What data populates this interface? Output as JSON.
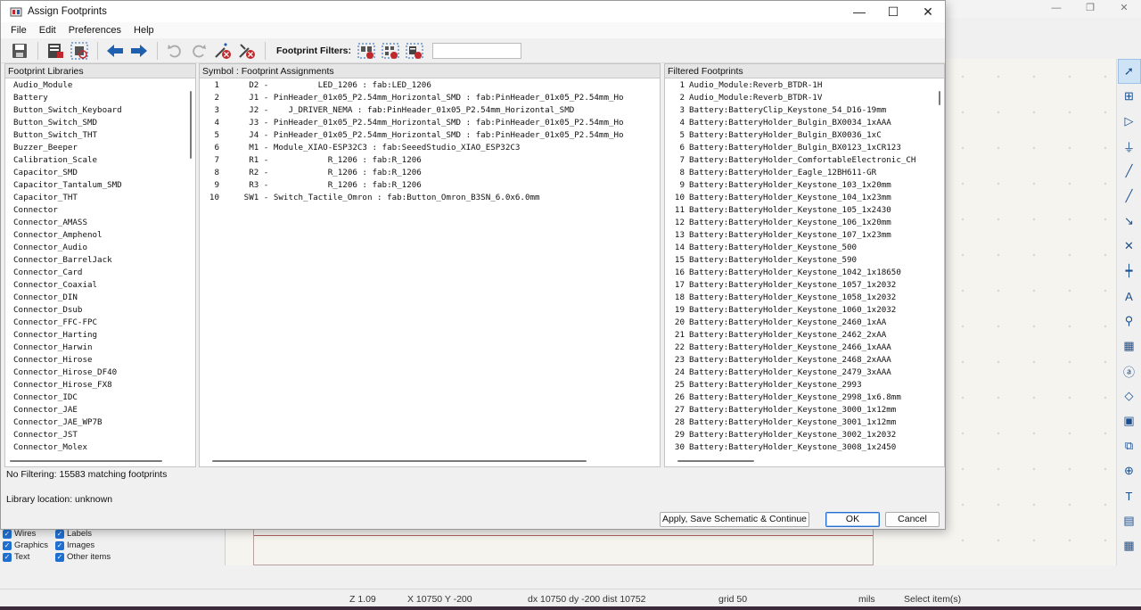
{
  "background": {
    "checkboxes": [
      {
        "label": "Wires"
      },
      {
        "label": "Labels"
      },
      {
        "label": "Graphics"
      },
      {
        "label": "Images"
      },
      {
        "label": "Text"
      },
      {
        "label": "Other items"
      }
    ],
    "status": {
      "zoom": "Z 1.09",
      "xy": "X 10750  Y -200",
      "delta": "dx 10750  dy -200  dist 10752",
      "grid": "grid 50",
      "units": "mils",
      "mode": "Select item(s)"
    }
  },
  "dialog": {
    "title": "Assign Footprints",
    "menu": [
      "File",
      "Edit",
      "Preferences",
      "Help"
    ],
    "filters_label": "Footprint Filters:",
    "filter_input_value": "",
    "libraries_header": "Footprint Libraries",
    "assignments_header": "Symbol : Footprint Assignments",
    "filtered_header": "Filtered Footprints",
    "libraries": [
      "Audio_Module",
      "Battery",
      "Button_Switch_Keyboard",
      "Button_Switch_SMD",
      "Button_Switch_THT",
      "Buzzer_Beeper",
      "Calibration_Scale",
      "Capacitor_SMD",
      "Capacitor_Tantalum_SMD",
      "Capacitor_THT",
      "Connector",
      "Connector_AMASS",
      "Connector_Amphenol",
      "Connector_Audio",
      "Connector_BarrelJack",
      "Connector_Card",
      "Connector_Coaxial",
      "Connector_DIN",
      "Connector_Dsub",
      "Connector_FFC-FPC",
      "Connector_Harting",
      "Connector_Harwin",
      "Connector_Hirose",
      "Connector_Hirose_DF40",
      "Connector_Hirose_FX8",
      "Connector_IDC",
      "Connector_JAE",
      "Connector_JAE_WP7B",
      "Connector_JST",
      "Connector_Molex"
    ],
    "assignments": [
      {
        "n": "1",
        "text": "      D2 -          LED_1206 : fab:LED_1206"
      },
      {
        "n": "2",
        "text": "      J1 - PinHeader_01x05_P2.54mm_Horizontal_SMD : fab:PinHeader_01x05_P2.54mm_Ho"
      },
      {
        "n": "3",
        "text": "      J2 -    J_DRIVER_NEMA : fab:PinHeader_01x05_P2.54mm_Horizontal_SMD"
      },
      {
        "n": "4",
        "text": "      J3 - PinHeader_01x05_P2.54mm_Horizontal_SMD : fab:PinHeader_01x05_P2.54mm_Ho"
      },
      {
        "n": "5",
        "text": "      J4 - PinHeader_01x05_P2.54mm_Horizontal_SMD : fab:PinHeader_01x05_P2.54mm_Ho"
      },
      {
        "n": "6",
        "text": "      M1 - Module_XIAO-ESP32C3 : fab:SeeedStudio_XIAO_ESP32C3"
      },
      {
        "n": "7",
        "text": "      R1 -            R_1206 : fab:R_1206"
      },
      {
        "n": "8",
        "text": "      R2 -            R_1206 : fab:R_1206"
      },
      {
        "n": "9",
        "text": "      R3 -            R_1206 : fab:R_1206"
      },
      {
        "n": "10",
        "text": "     SW1 - Switch_Tactile_Omron : fab:Button_Omron_B3SN_6.0x6.0mm"
      }
    ],
    "filtered": [
      {
        "n": "1",
        "name": "Audio_Module:Reverb_BTDR-1H"
      },
      {
        "n": "2",
        "name": "Audio_Module:Reverb_BTDR-1V"
      },
      {
        "n": "3",
        "name": "Battery:BatteryClip_Keystone_54_D16-19mm"
      },
      {
        "n": "4",
        "name": "Battery:BatteryHolder_Bulgin_BX0034_1xAAA"
      },
      {
        "n": "5",
        "name": "Battery:BatteryHolder_Bulgin_BX0036_1xC"
      },
      {
        "n": "6",
        "name": "Battery:BatteryHolder_Bulgin_BX0123_1xCR123"
      },
      {
        "n": "7",
        "name": "Battery:BatteryHolder_ComfortableElectronic_CH"
      },
      {
        "n": "8",
        "name": "Battery:BatteryHolder_Eagle_12BH611-GR"
      },
      {
        "n": "9",
        "name": "Battery:BatteryHolder_Keystone_103_1x20mm"
      },
      {
        "n": "10",
        "name": "Battery:BatteryHolder_Keystone_104_1x23mm"
      },
      {
        "n": "11",
        "name": "Battery:BatteryHolder_Keystone_105_1x2430"
      },
      {
        "n": "12",
        "name": "Battery:BatteryHolder_Keystone_106_1x20mm"
      },
      {
        "n": "13",
        "name": "Battery:BatteryHolder_Keystone_107_1x23mm"
      },
      {
        "n": "14",
        "name": "Battery:BatteryHolder_Keystone_500"
      },
      {
        "n": "15",
        "name": "Battery:BatteryHolder_Keystone_590"
      },
      {
        "n": "16",
        "name": "Battery:BatteryHolder_Keystone_1042_1x18650"
      },
      {
        "n": "17",
        "name": "Battery:BatteryHolder_Keystone_1057_1x2032"
      },
      {
        "n": "18",
        "name": "Battery:BatteryHolder_Keystone_1058_1x2032"
      },
      {
        "n": "19",
        "name": "Battery:BatteryHolder_Keystone_1060_1x2032"
      },
      {
        "n": "20",
        "name": "Battery:BatteryHolder_Keystone_2460_1xAA"
      },
      {
        "n": "21",
        "name": "Battery:BatteryHolder_Keystone_2462_2xAA"
      },
      {
        "n": "22",
        "name": "Battery:BatteryHolder_Keystone_2466_1xAAA"
      },
      {
        "n": "23",
        "name": "Battery:BatteryHolder_Keystone_2468_2xAAA"
      },
      {
        "n": "24",
        "name": "Battery:BatteryHolder_Keystone_2479_3xAAA"
      },
      {
        "n": "25",
        "name": "Battery:BatteryHolder_Keystone_2993"
      },
      {
        "n": "26",
        "name": "Battery:BatteryHolder_Keystone_2998_1x6.8mm"
      },
      {
        "n": "27",
        "name": "Battery:BatteryHolder_Keystone_3000_1x12mm"
      },
      {
        "n": "28",
        "name": "Battery:BatteryHolder_Keystone_3001_1x12mm"
      },
      {
        "n": "29",
        "name": "Battery:BatteryHolder_Keystone_3002_1x2032"
      },
      {
        "n": "30",
        "name": "Battery:BatteryHolder_Keystone_3008_1x2450"
      }
    ],
    "filter_status": "No Filtering: 15583 matching footprints",
    "library_location": "Library location: unknown",
    "buttons": {
      "apply": "Apply, Save Schematic & Continue",
      "ok": "OK",
      "cancel": "Cancel"
    },
    "colors": {
      "accent": "#1f6fd1",
      "toolbar_blue": "#1f5fb0",
      "toolbar_red": "#c0282d"
    }
  }
}
